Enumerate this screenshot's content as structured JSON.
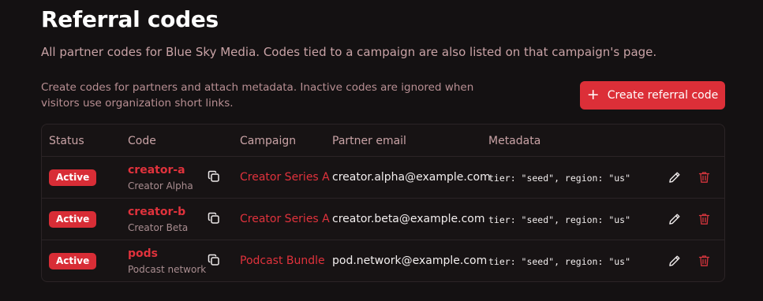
{
  "header": {
    "title": "Referral codes",
    "subtitle": "All partner codes for Blue Sky Media. Codes tied to a campaign are also listed on that campaign's page."
  },
  "helper_text": "Create codes for partners and attach metadata. Inactive codes are ignored when visitors use organization short links.",
  "create_button": {
    "label": "Create referral code",
    "icon": "plus-icon"
  },
  "table": {
    "columns": [
      "Status",
      "Code",
      "Campaign",
      "Partner email",
      "Metadata"
    ],
    "rows": [
      {
        "status": "Active",
        "code": "creator-a",
        "code_name": "Creator Alpha",
        "campaign": "Creator Series A",
        "email": "creator.alpha@example.com",
        "metadata": "tier: \"seed\", region: \"us\""
      },
      {
        "status": "Active",
        "code": "creator-b",
        "code_name": "Creator Beta",
        "campaign": "Creator Series A",
        "email": "creator.beta@example.com",
        "metadata": "tier: \"seed\", region: \"us\""
      },
      {
        "status": "Active",
        "code": "pods",
        "code_name": "Podcast network",
        "campaign": "Podcast Bundle",
        "email": "pod.network@example.com",
        "metadata": "tier: \"seed\", region: \"us\""
      }
    ]
  },
  "colors": {
    "background": "#141112",
    "accent": "#dc2f38",
    "muted_text": "#c9a3a6",
    "border": "#2b2426"
  }
}
